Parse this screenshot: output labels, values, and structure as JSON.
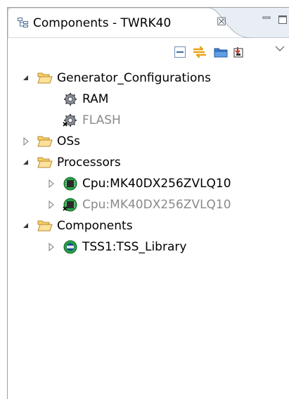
{
  "tab": {
    "title": "Components - TWRK40",
    "close_glyph": "☒"
  },
  "toolbar": {
    "buttons": [
      "collapse-all-icon",
      "link-with-editor-icon",
      "folder-icon",
      "export-icon",
      "view-menu-icon"
    ]
  },
  "tree": {
    "generator_configurations": {
      "label": "Generator_Configurations",
      "expanded": true,
      "children": [
        {
          "label": "RAM",
          "disabled": false
        },
        {
          "label": "FLASH",
          "disabled": true
        }
      ]
    },
    "oss": {
      "label": "OSs",
      "expanded": false
    },
    "processors": {
      "label": "Processors",
      "expanded": true,
      "children": [
        {
          "label": "Cpu:MK40DX256ZVLQ10",
          "disabled": false
        },
        {
          "label": "Cpu:MK40DX256ZVLQ10",
          "disabled": true
        }
      ]
    },
    "components": {
      "label": "Components",
      "expanded": true,
      "children": [
        {
          "label": "TSS1:TSS_Library",
          "disabled": false
        }
      ]
    }
  },
  "colors": {
    "tab_background": "#e9eef5",
    "folder_fill": "#f6d169",
    "disabled_text": "#8a8a8a"
  }
}
